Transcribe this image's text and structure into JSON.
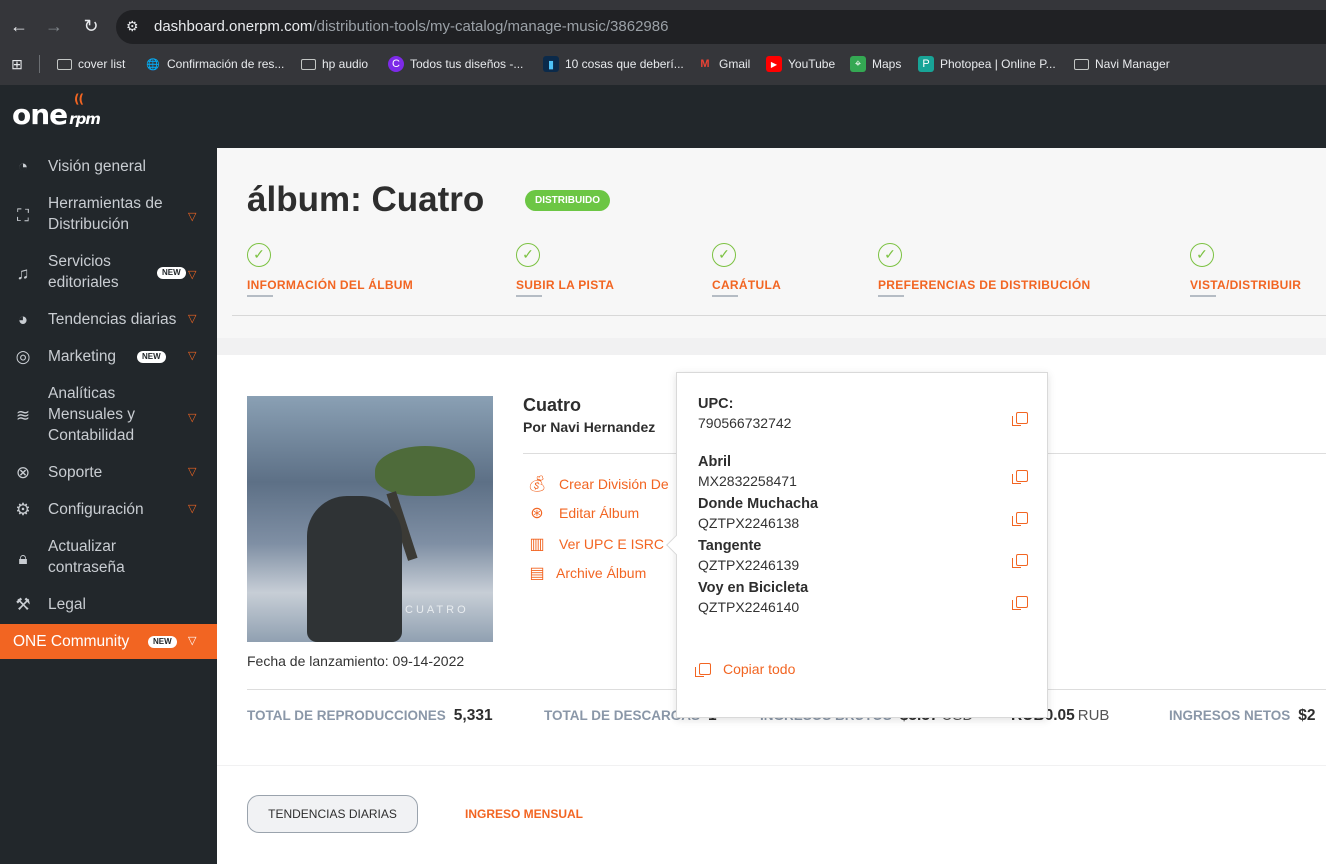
{
  "browser": {
    "url_domain": "dashboard.onerpm.com",
    "url_path": "/distribution-tools/my-catalog/manage-music/3862986",
    "bookmarks": [
      {
        "label": "cover list",
        "icon": "folder-icon"
      },
      {
        "label": "Confirmación de res...",
        "icon": "globe-icon"
      },
      {
        "label": "hp audio",
        "icon": "folder-icon"
      },
      {
        "label": "Todos tus diseños -...",
        "icon": "canva-icon"
      },
      {
        "label": "10 cosas que deberí...",
        "icon": "audio-icon"
      },
      {
        "label": "Gmail",
        "icon": "gmail-icon"
      },
      {
        "label": "YouTube",
        "icon": "youtube-icon"
      },
      {
        "label": "Maps",
        "icon": "maps-icon"
      },
      {
        "label": "Photopea | Online P...",
        "icon": "photopea-icon"
      },
      {
        "label": "Navi Manager",
        "icon": "folder-icon"
      }
    ]
  },
  "logo": {
    "main": "one",
    "sub": "rpm"
  },
  "sidebar": {
    "items": [
      {
        "label": "Visión general",
        "icon": "dashboard-icon"
      },
      {
        "label": "Herramientas de\nDistribución",
        "icon": "distribution-icon"
      },
      {
        "label": "Servicios\neditoriales",
        "icon": "music-icon",
        "badge": "NEW"
      },
      {
        "label": "Tendencias diarias",
        "icon": "pie-chart-icon"
      },
      {
        "label": "Marketing",
        "icon": "target-icon",
        "badge": "NEW"
      },
      {
        "label": "Analíticas\nMensuales y\nContabilidad",
        "icon": "coins-icon"
      },
      {
        "label": "Soporte",
        "icon": "support-icon"
      },
      {
        "label": "Configuración",
        "icon": "gear-icon"
      },
      {
        "label": "Actualizar\ncontraseña",
        "icon": "lock-icon"
      },
      {
        "label": "Legal",
        "icon": "gavel-icon"
      },
      {
        "label": "ONE Community",
        "icon": "",
        "badge": "NEW"
      }
    ]
  },
  "header": {
    "title": "álbum: Cuatro",
    "status": "DISTRIBUIDO",
    "steps": [
      "INFORMACIÓN DEL ÁLBUM",
      "SUBIR LA PISTA",
      "CARÁTULA",
      "PREFERENCIAS DE DISTRIBUCIÓN",
      "VISTA/DISTRIBUIR"
    ]
  },
  "album": {
    "cover_text": "CUATRO",
    "title": "Cuatro",
    "artist": "Por Navi Hernandez",
    "release": "Fecha de lanzamiento: 09-14-2022",
    "actions": [
      "Crear División De",
      "Editar Álbum",
      "Ver UPC E ISRC",
      "Archive Álbum"
    ]
  },
  "stats": {
    "streams_label": "TOTAL DE REPRODUCCIONES",
    "streams_value": "5,331",
    "downloads_label": "TOTAL DE DESCARGAS",
    "downloads_value": "1",
    "gross_label": "INGRESOS BRUTOS",
    "gross_value": "$5.57",
    "gross_unit": "USD",
    "rub_value": "RUB0.05",
    "rub_unit": "RUB",
    "net_label": "INGRESOS NETOS",
    "net_value": "$2"
  },
  "tabs": {
    "daily": "TENDENCIAS DIARIAS",
    "monthly": "INGRESO MENSUAL"
  },
  "popup": {
    "upc_label": "UPC:",
    "upc_value": "790566732742",
    "tracks": [
      {
        "name": "Abril",
        "isrc": "MX2832258471"
      },
      {
        "name": "Donde Muchacha",
        "isrc": "QZTPX2246138"
      },
      {
        "name": "Tangente",
        "isrc": "QZTPX2246139"
      },
      {
        "name": "Voy en Bicicleta",
        "isrc": "QZTPX2246140"
      }
    ],
    "copy_all": "Copiar todo"
  }
}
